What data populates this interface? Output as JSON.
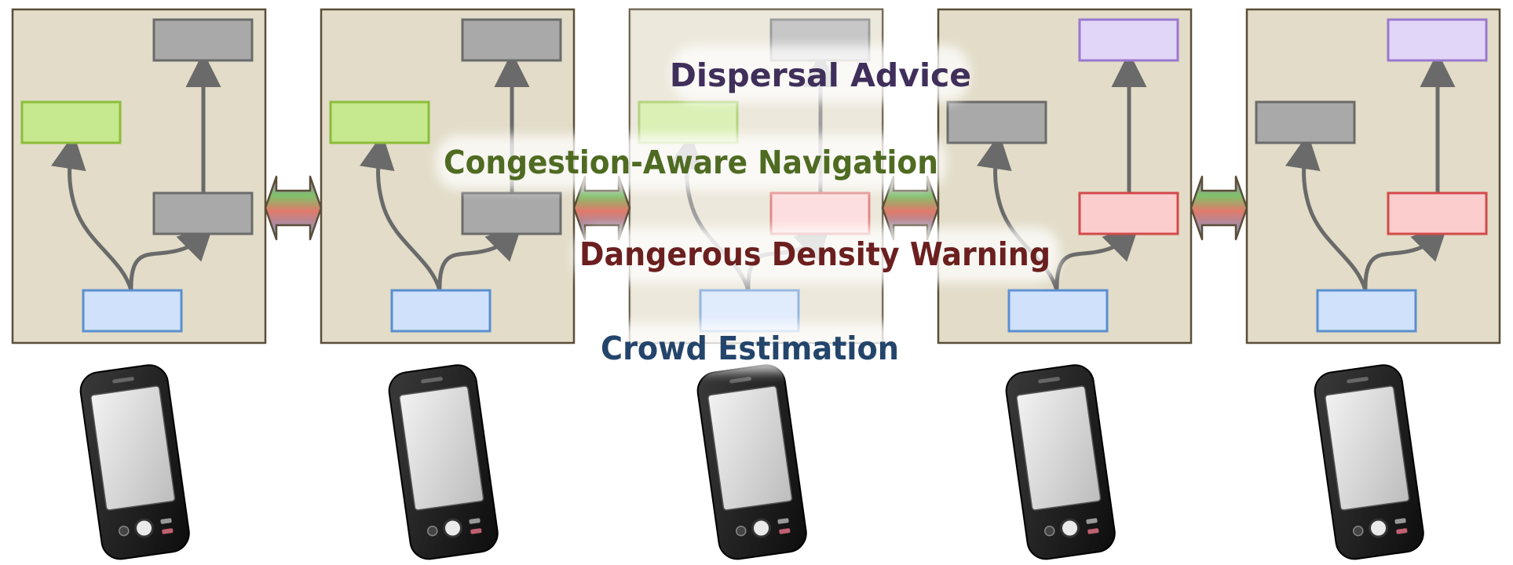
{
  "labels": {
    "dispersal": "Dispersal Advice",
    "navigation": "Congestion-Aware Navigation",
    "warning": "Dangerous Density Warning",
    "estimation": "Crowd Estimation"
  },
  "colors": {
    "panel_fill": "#e2dcc8",
    "panel_border": "#5a4e38",
    "gray_box": "#a9a9a9",
    "gray_border": "#6b6b6b",
    "green_box": "#c6e88e",
    "green_border": "#8cbd3a",
    "blue_box": "#cfe1fb",
    "blue_border": "#5b8fcf",
    "red_box": "#fccdcd",
    "red_border": "#d14a4a",
    "purple_box": "#e2d6f8",
    "purple_border": "#9a78cf",
    "arrow": "#6a6a6a",
    "dispersal_text": "#3f2f5a",
    "navigation_text": "#4f6b22",
    "warning_text": "#6b1f1f",
    "estimation_text": "#24456b"
  },
  "devices": [
    {
      "id": 1,
      "top": "gray",
      "middle": "gray",
      "left": "green",
      "bottom": "blue"
    },
    {
      "id": 2,
      "top": "gray",
      "middle": "gray",
      "left": "green",
      "bottom": "blue"
    },
    {
      "id": 3,
      "top": "gray",
      "middle": "red",
      "left": "green",
      "bottom": "blue"
    },
    {
      "id": 4,
      "top": "purple",
      "middle": "red",
      "left": "gray",
      "bottom": "blue"
    },
    {
      "id": 5,
      "top": "purple",
      "middle": "red",
      "left": "gray",
      "bottom": "blue"
    }
  ],
  "links": [
    {
      "from": 1,
      "to": 2
    },
    {
      "from": 2,
      "to": 3
    },
    {
      "from": 3,
      "to": 4
    },
    {
      "from": 4,
      "to": 5
    }
  ],
  "icons": {
    "phone": "smartphone-icon",
    "link": "double-arrow-icon"
  }
}
